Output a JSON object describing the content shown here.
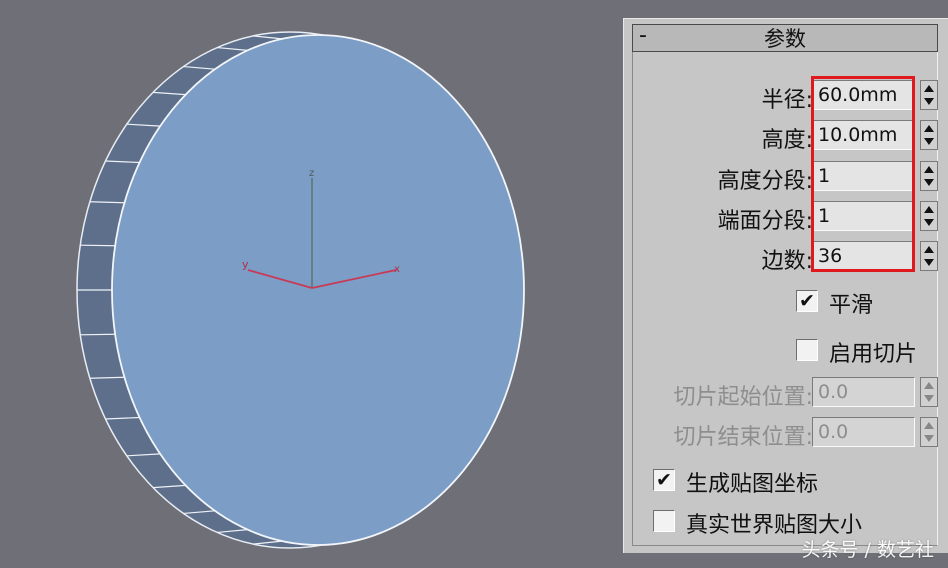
{
  "panel": {
    "collapse_symbol": "-",
    "title": "参数",
    "fields": [
      {
        "label": "半径:",
        "value": "60.0mm",
        "enabled": true
      },
      {
        "label": "高度:",
        "value": "10.0mm",
        "enabled": true
      },
      {
        "label": "高度分段:",
        "value": "1",
        "enabled": true
      },
      {
        "label": "端面分段:",
        "value": "1",
        "enabled": true
      },
      {
        "label": "边数:",
        "value": "36",
        "enabled": true
      }
    ],
    "smooth": {
      "label": "平滑",
      "checked": true,
      "mark": "✔"
    },
    "slice_on": {
      "label": "启用切片",
      "checked": false,
      "mark": ""
    },
    "slice_fields": [
      {
        "label": "切片起始位置:",
        "value": "0.0",
        "enabled": false
      },
      {
        "label": "切片结束位置:",
        "value": "0.0",
        "enabled": false
      }
    ],
    "gen_mapping": {
      "label": "生成贴图坐标",
      "checked": true,
      "mark": "✔"
    },
    "real_world": {
      "label": "真实世界贴图大小",
      "checked": false,
      "mark": ""
    }
  },
  "viewport": {
    "background_color": "#6f7077",
    "object_color": "#7b9dc6",
    "gizmo": {
      "z_label": "z",
      "y_label": "y",
      "x_label": "x"
    }
  },
  "highlight_color": "#e0191f",
  "watermark": "头条号 / 数艺社"
}
